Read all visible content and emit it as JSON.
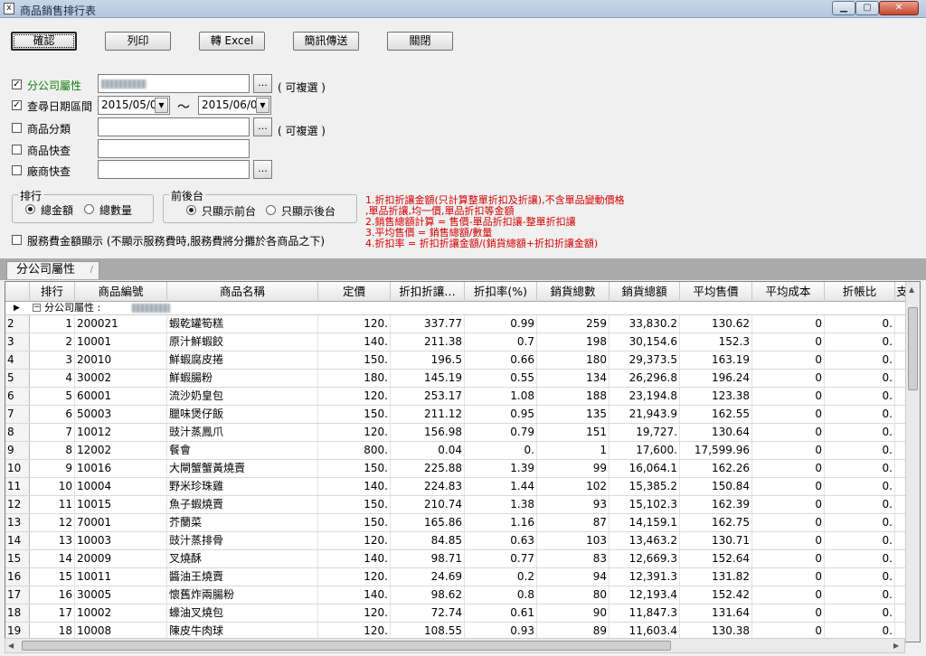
{
  "window": {
    "title": "商品銷售排行表",
    "icon_text": "x"
  },
  "toolbar": {
    "confirm": "確認",
    "print": "列印",
    "excel": "轉 Excel",
    "sms": "簡訊傳送",
    "close": "關閉"
  },
  "filters": {
    "branch": {
      "label": "分公司屬性",
      "checked": true,
      "note": "( 可複選 )"
    },
    "date": {
      "label": "查尋日期區間",
      "checked": true,
      "from": "2015/05/02",
      "separator": "～",
      "to": "2015/06/02"
    },
    "category": {
      "label": "商品分類",
      "checked": false,
      "note": "( 可複選 )"
    },
    "product": {
      "label": "商品快查",
      "checked": false
    },
    "vendor": {
      "label": "廠商快查",
      "checked": false
    },
    "ellipsis": "..."
  },
  "ranking": {
    "title": "排行",
    "opt_amount": "總金額",
    "opt_qty": "總數量",
    "selected": "amount"
  },
  "frontback": {
    "title": "前後台",
    "opt_front": "只顯示前台",
    "opt_back": "只顯示後台",
    "selected": "front"
  },
  "service_fee": {
    "label": "服務費金額顯示 (不顯示服務費時,服務費將分攤於各商品之下)",
    "checked": false
  },
  "notes": [
    "1.折扣折讓金額(只計算整單折扣及折讓),不含單品變動價格",
    ",單品折讓,均一價,單品折扣等金額",
    "2.銷售總額計算 = 售價-單品折扣讓-整單折扣讓",
    "3.平均售價 = 銷售總額/數量",
    "4.折扣率 = 折扣折讓金額/(銷貨總額+折扣折讓金額)"
  ],
  "grid": {
    "tab": "分公司屬性",
    "group_label": "分公司屬性 :",
    "columns": [
      "排行",
      "商品編號",
      "商品名稱",
      "定價",
      "折扣折讓…",
      "折扣率(%)",
      "銷貨總數",
      "銷貨總額",
      "平均售價",
      "平均成本",
      "折帳比",
      "支"
    ],
    "rows": [
      [
        "2",
        "1",
        "200021",
        "蝦乾罐筍糕",
        "120.",
        "337.77",
        "0.99",
        "259",
        "33,830.2",
        "130.62",
        "0",
        "0."
      ],
      [
        "3",
        "2",
        "10001",
        "原汁鮮蝦餃",
        "140.",
        "211.38",
        "0.7",
        "198",
        "30,154.6",
        "152.3",
        "0",
        "0."
      ],
      [
        "4",
        "3",
        "20010",
        "鮮蝦腐皮捲",
        "150.",
        "196.5",
        "0.66",
        "180",
        "29,373.5",
        "163.19",
        "0",
        "0."
      ],
      [
        "5",
        "4",
        "30002",
        "鮮蝦腸粉",
        "180.",
        "145.19",
        "0.55",
        "134",
        "26,296.8",
        "196.24",
        "0",
        "0."
      ],
      [
        "6",
        "5",
        "60001",
        "流沙奶皇包",
        "120.",
        "253.17",
        "1.08",
        "188",
        "23,194.8",
        "123.38",
        "0",
        "0."
      ],
      [
        "7",
        "6",
        "50003",
        "臘味煲仔飯",
        "150.",
        "211.12",
        "0.95",
        "135",
        "21,943.9",
        "162.55",
        "0",
        "0."
      ],
      [
        "8",
        "7",
        "10012",
        "豉汁蒸鳳爪",
        "120.",
        "156.98",
        "0.79",
        "151",
        "19,727.",
        "130.64",
        "0",
        "0."
      ],
      [
        "9",
        "8",
        "12002",
        "餐會",
        "800.",
        "0.04",
        "0.",
        "1",
        "17,600.",
        "17,599.96",
        "0",
        "0."
      ],
      [
        "10",
        "9",
        "10016",
        "大閘蟹蟹黃燒賣",
        "150.",
        "225.88",
        "1.39",
        "99",
        "16,064.1",
        "162.26",
        "0",
        "0."
      ],
      [
        "11",
        "10",
        "10004",
        "野米珍珠雞",
        "140.",
        "224.83",
        "1.44",
        "102",
        "15,385.2",
        "150.84",
        "0",
        "0."
      ],
      [
        "12",
        "11",
        "10015",
        "魚子蝦燒賣",
        "150.",
        "210.74",
        "1.38",
        "93",
        "15,102.3",
        "162.39",
        "0",
        "0."
      ],
      [
        "13",
        "12",
        "70001",
        "芥蘭菜",
        "150.",
        "165.86",
        "1.16",
        "87",
        "14,159.1",
        "162.75",
        "0",
        "0."
      ],
      [
        "14",
        "13",
        "10003",
        "豉汁蒸排骨",
        "120.",
        "84.85",
        "0.63",
        "103",
        "13,463.2",
        "130.71",
        "0",
        "0."
      ],
      [
        "15",
        "14",
        "20009",
        "叉燒酥",
        "140.",
        "98.71",
        "0.77",
        "83",
        "12,669.3",
        "152.64",
        "0",
        "0."
      ],
      [
        "16",
        "15",
        "10011",
        "醬油王燒賣",
        "120.",
        "24.69",
        "0.2",
        "94",
        "12,391.3",
        "131.82",
        "0",
        "0."
      ],
      [
        "17",
        "16",
        "30005",
        "懷舊炸兩腸粉",
        "140.",
        "98.62",
        "0.8",
        "80",
        "12,193.4",
        "152.42",
        "0",
        "0."
      ],
      [
        "18",
        "17",
        "10002",
        "蠔油叉燒包",
        "120.",
        "72.74",
        "0.61",
        "90",
        "11,847.3",
        "131.64",
        "0",
        "0."
      ],
      [
        "19",
        "18",
        "10008",
        "陳皮牛肉球",
        "120.",
        "108.55",
        "0.93",
        "89",
        "11,603.4",
        "130.38",
        "0",
        "0."
      ]
    ]
  }
}
